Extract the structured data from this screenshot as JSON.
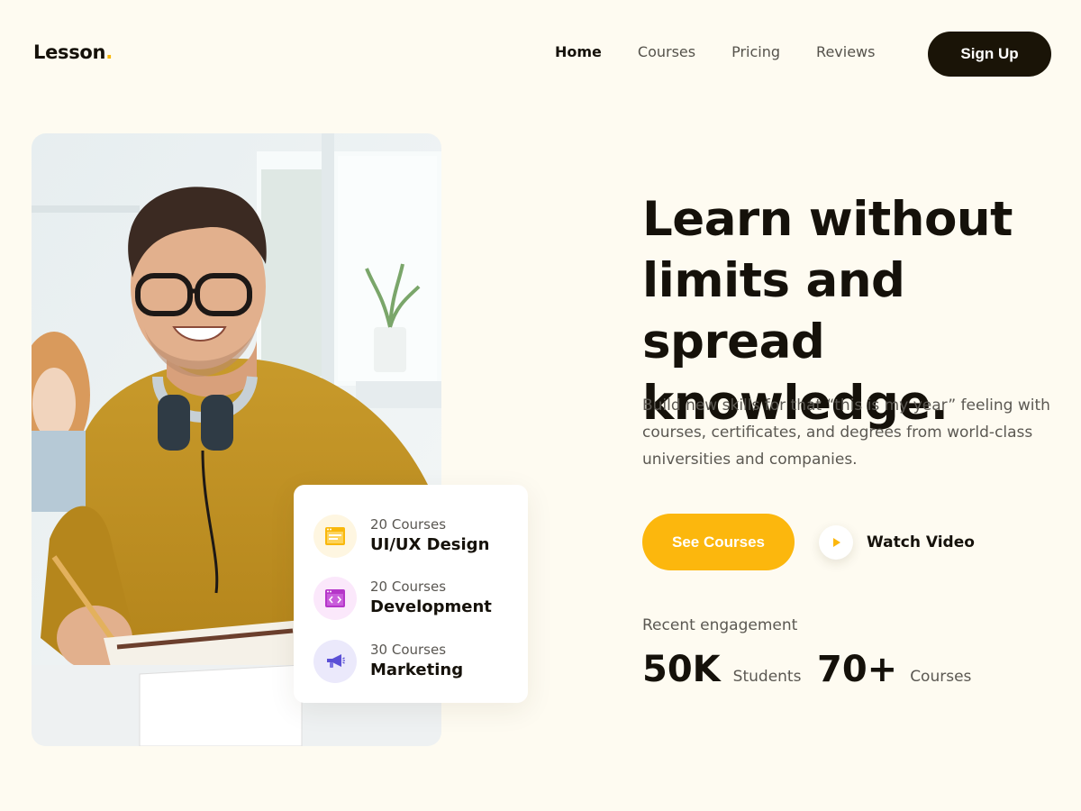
{
  "brand": {
    "name": "Lesson",
    "dot": "."
  },
  "nav": {
    "items": [
      {
        "label": "Home",
        "active": true
      },
      {
        "label": "Courses",
        "active": false
      },
      {
        "label": "Pricing",
        "active": false
      },
      {
        "label": "Reviews",
        "active": false
      }
    ],
    "signup_label": "Sign Up"
  },
  "categories": [
    {
      "count": "20 Courses",
      "name": "UI/UX Design",
      "icon": "ui-ux-design-icon",
      "color": "#f9b80b",
      "bg": "#fef6e1"
    },
    {
      "count": "20 Courses",
      "name": "Development",
      "icon": "code-window-icon",
      "color": "#b536c9",
      "bg": "#fbe8fb"
    },
    {
      "count": "30 Courses",
      "name": "Marketing",
      "icon": "megaphone-icon",
      "color": "#5b50d6",
      "bg": "#ebe9fb"
    }
  ],
  "hero": {
    "title_lines": [
      "Learn without",
      "limits and spread",
      "knowledge."
    ],
    "description": "Build new skills for that “this is my year” feeling with courses, certificates, and degrees from world-class universities and companies.",
    "primary_cta": "See Courses",
    "secondary_cta": "Watch Video"
  },
  "engagement": {
    "label": "Recent engagement",
    "stats": [
      {
        "value": "50K",
        "label": "Students"
      },
      {
        "value": "70+",
        "label": "Courses"
      }
    ]
  },
  "colors": {
    "accent": "#fcb70d",
    "dark": "#1a1407",
    "background": "#fefbf1"
  }
}
